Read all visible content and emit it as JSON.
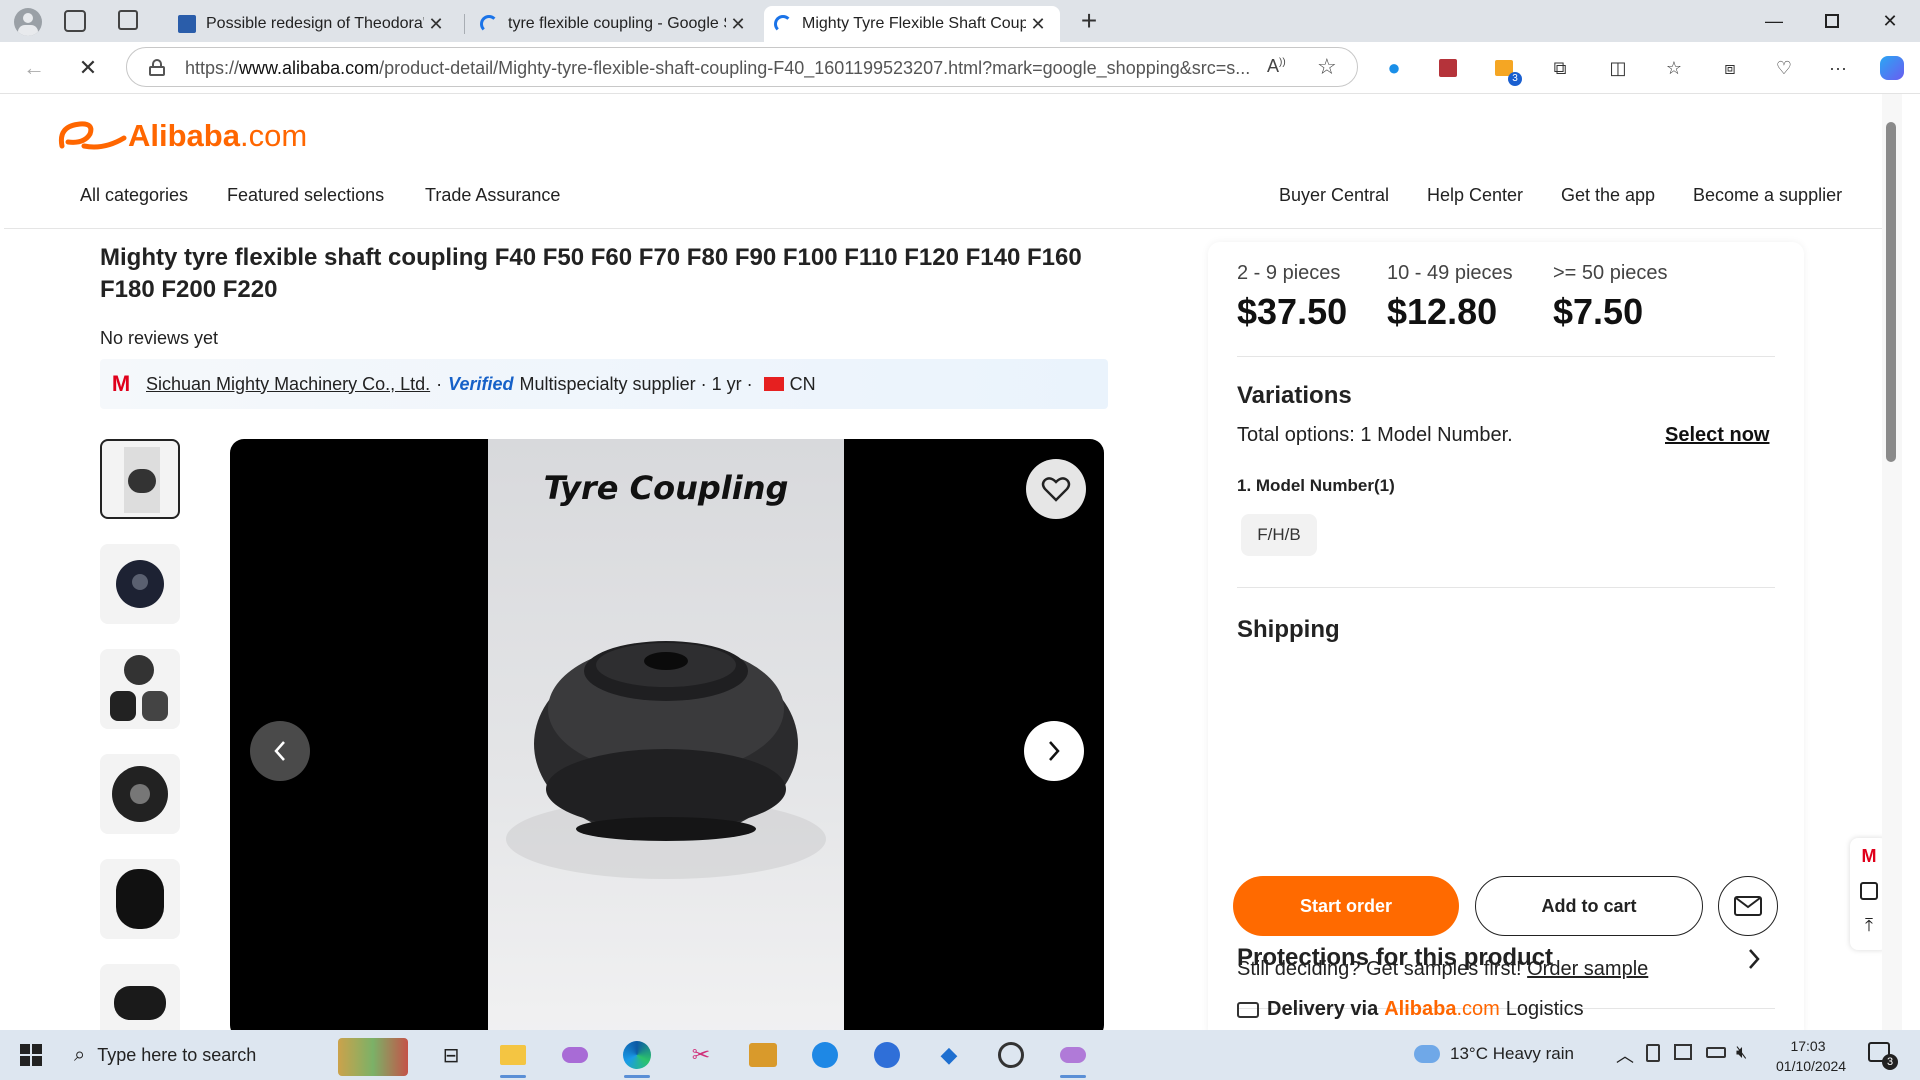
{
  "browser": {
    "tabs": [
      {
        "title": "Possible redesign of Theodora's e",
        "icon": "document-icon"
      },
      {
        "title": "tyre flexible coupling - Google Se",
        "icon": "loading-spinner-icon"
      },
      {
        "title": "Mighty Tyre Flexible Shaft Coupli",
        "icon": "loading-spinner-icon"
      }
    ],
    "active_tab": 2,
    "url_prefix": "https://",
    "url_domain": "www.alibaba.com",
    "url_rest": "/product-detail/Mighty-tyre-flexible-shaft-coupling-F40_1601199523207.html?mark=google_shopping&src=s...",
    "extension_badge": "3"
  },
  "site": {
    "logo_main": "Alibaba",
    "logo_suffix": ".com",
    "nav_left": [
      "All categories",
      "Featured selections",
      "Trade Assurance"
    ],
    "nav_right": [
      "Buyer Central",
      "Help Center",
      "Get the app",
      "Become a supplier"
    ]
  },
  "product": {
    "title": "Mighty tyre flexible shaft coupling F40 F50 F60 F70 F80 F90 F100 F110 F120 F140 F160 F180 F200 F220",
    "reviews": "No reviews yet",
    "supplier": {
      "logo_text": "M",
      "name": "Sichuan Mighty Machinery Co., Ltd.",
      "sep1": "·",
      "verified": "Verified",
      "type": "Multispecialty supplier",
      "sep2": "·",
      "years": "1 yr",
      "sep3": "·",
      "country": "CN"
    },
    "image_caption": "Tyre Coupling",
    "thumbnail_count": 6
  },
  "pricing": {
    "tiers": [
      {
        "qty": "2 - 9 pieces",
        "price": "$37.50"
      },
      {
        "qty": "10 - 49 pieces",
        "price": "$12.80"
      },
      {
        "qty": ">= 50 pieces",
        "price": "$7.50"
      }
    ],
    "variations_title": "Variations",
    "total_options": "Total options: 1 Model Number.",
    "select_now": "Select now",
    "model_label": "1. Model Number(1)",
    "model_option": "F/H/B",
    "shipping_title": "Shipping",
    "start_order": "Start order",
    "add_to_cart": "Add to cart",
    "samples_text": "Still deciding? Get samples first!",
    "order_sample": "Order sample",
    "protections_title": "Protections for this product",
    "delivery_prefix": "Delivery via",
    "delivery_brand": "Alibaba",
    "delivery_brand_suffix": ".com",
    "delivery_suffix": "Logistics"
  },
  "taskbar": {
    "search_placeholder": "Type here to search",
    "weather": "13°C  Heavy rain",
    "time": "17:03",
    "date": "01/10/2024",
    "notification_count": "3"
  },
  "colors": {
    "accent_orange": "#ff6600",
    "start_order_bg": "#ff6a00",
    "verified_blue": "#1661c8"
  }
}
